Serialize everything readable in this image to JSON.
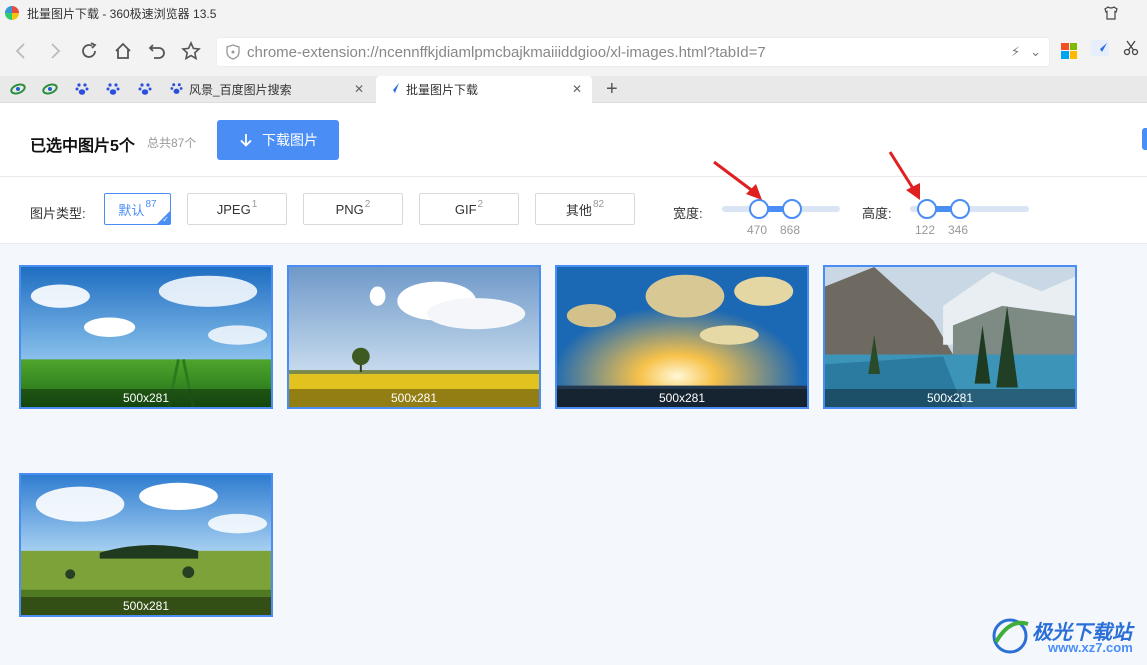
{
  "window": {
    "title": "批量图片下载 - 360极速浏览器 13.5"
  },
  "address_bar": {
    "url": "chrome-extension://ncennffkjdiamlpmcbajkmaiiiddgioo/xl-images.html?tabId=7"
  },
  "tabs": [
    {
      "label": "风景_百度图片搜索",
      "icon": "baidu-paw-icon"
    },
    {
      "label": "批量图片下载",
      "icon": "swallow-icon"
    }
  ],
  "header": {
    "selected": "已选中图片5个",
    "total": "总共87个",
    "download_label": "下载图片"
  },
  "filter": {
    "type_label": "图片类型:",
    "types": [
      {
        "label": "默认",
        "count": "87",
        "selected": true
      },
      {
        "label": "JPEG",
        "count": "1"
      },
      {
        "label": "PNG",
        "count": "2"
      },
      {
        "label": "GIF",
        "count": "2"
      },
      {
        "label": "其他",
        "count": "82"
      }
    ],
    "width": {
      "label": "宽度:",
      "min": "470",
      "max": "868"
    },
    "height": {
      "label": "高度:",
      "min": "122",
      "max": "346"
    }
  },
  "images": [
    {
      "size": "500x281",
      "scene": "grassland-sky"
    },
    {
      "size": "500x281",
      "scene": "tree-field"
    },
    {
      "size": "500x281",
      "scene": "sunset-clouds"
    },
    {
      "size": "500x281",
      "scene": "mountain-lake"
    },
    {
      "size": "500x281",
      "scene": "meadow-trees"
    }
  ],
  "watermark": {
    "name": "极光下载站",
    "url": "www.xz7.com"
  },
  "colors": {
    "accent": "#4a8ef5",
    "page_bg": "#f4f7fc",
    "arrow": "#e02020"
  }
}
